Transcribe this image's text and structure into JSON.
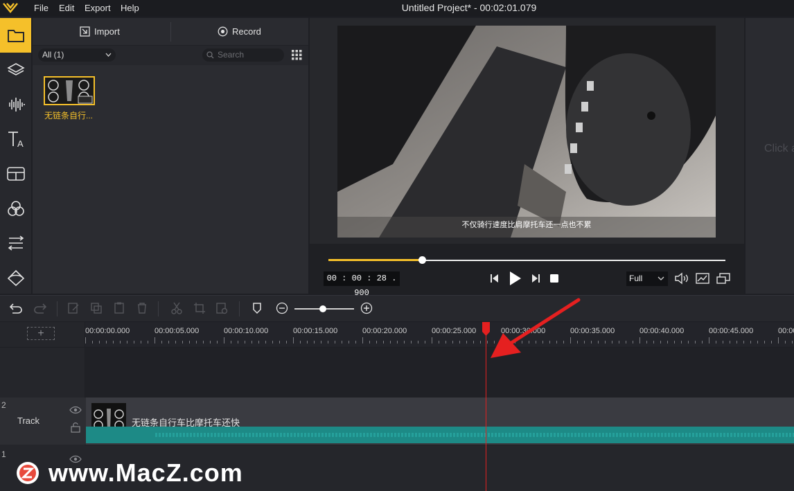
{
  "titlebar": {
    "menu": [
      "File",
      "Edit",
      "Export",
      "Help"
    ],
    "window_title": "Untitled Project* - 00:02:01.079"
  },
  "media": {
    "import_label": "Import",
    "record_label": "Record",
    "filter_value": "All (1)",
    "search_placeholder": "Search",
    "item_name": "无链条自行..."
  },
  "preview": {
    "subtitle": "不仅骑行速度比肩摩托车还一点也不累",
    "timecode": "00 : 00 : 28 . 900",
    "progress_fraction": 0.235,
    "zoom_value": "Full",
    "right_hint": "Click a"
  },
  "timeline": {
    "zoom_fraction": 0.48,
    "ruler_ticks": [
      "00:00:00.000",
      "00:00:05.000",
      "00:00:10.000",
      "00:00:15.000",
      "00:00:20.000",
      "00:00:25.000",
      "00:00:30.000",
      "00:00:35.000",
      "00:00:40.000",
      "00:00:45.000",
      "00:00:50.000"
    ],
    "playhead_seconds": 28.9,
    "tracks": [
      {
        "number": "2",
        "label": "Track",
        "clip_title": "无链条自行车比摩托车还快"
      },
      {
        "number": "1",
        "label": ""
      }
    ]
  },
  "watermark": "www.MacZ.com",
  "colors": {
    "accent": "#f5c02a",
    "audio": "#1d8a86",
    "playhead": "#e52020"
  }
}
